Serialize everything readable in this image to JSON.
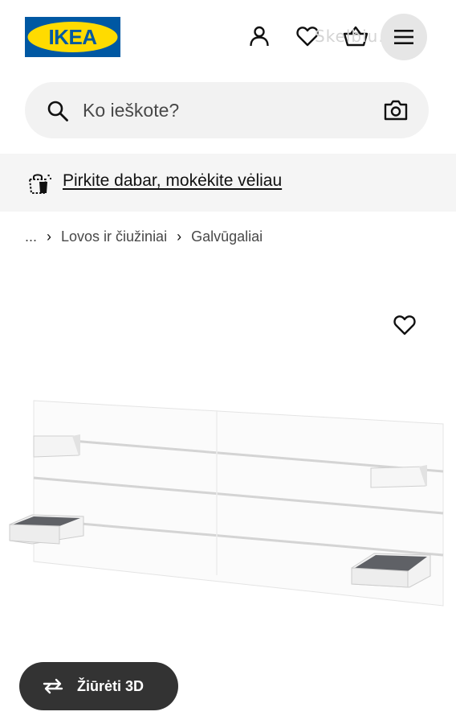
{
  "header": {
    "logo_text": "IKEA",
    "watermark_text": "Skelbiu.lt",
    "icons": [
      "user-icon",
      "heart-icon",
      "basket-icon",
      "hamburger-menu-icon"
    ]
  },
  "search": {
    "placeholder": "Ko ieškote?",
    "icons": [
      "search-icon",
      "camera-icon"
    ]
  },
  "banner": {
    "text": "Pirkite dabar, mokėkite vėliau",
    "icon": "shopping-bag-icon"
  },
  "breadcrumb": {
    "items": [
      "...",
      "Lovos ir čiužiniai",
      "Galvūgaliai"
    ],
    "separator": "›"
  },
  "product": {
    "image": "white headboard with two shelves",
    "favorite_icon": "heart-icon"
  },
  "view3d": {
    "label": "Žiūrėti 3D",
    "icon": "rotate-3d-icon"
  },
  "colors": {
    "brand_blue": "#0058a3",
    "brand_yellow": "#ffdb00",
    "button_dark": "#333333",
    "search_bg": "#f2f2f2"
  }
}
